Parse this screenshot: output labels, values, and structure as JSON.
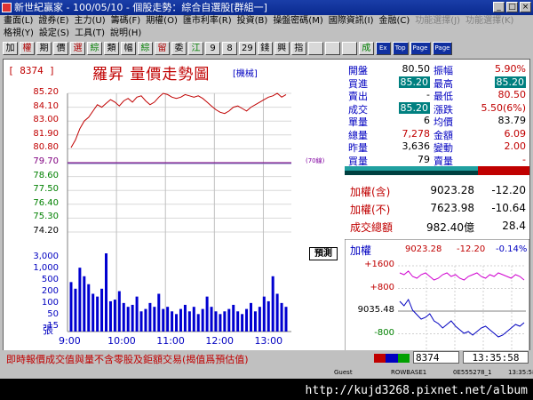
{
  "window": {
    "app_name": "新世紀贏家",
    "title_rest": " - 100/05/10 - 個股走勢：綜合自選股[群組一]",
    "buttons": [
      "_",
      "□",
      "×"
    ]
  },
  "menu": {
    "row1": [
      "畫面(L)",
      "證券(E)",
      "主力(U)",
      "籌碼(F)",
      "期權(O)",
      "匯市利率(R)",
      "投資(B)",
      "操盤密碼(M)",
      "國際資訊(I)",
      "金融(C)",
      "功能選擇(J)",
      "功能選擇(K)"
    ],
    "row2": [
      "格視(Y)",
      "設定(S)",
      "工具(T)",
      "說明(H)"
    ]
  },
  "toolbar": [
    "加",
    "權",
    "期",
    "價",
    "選",
    "綜",
    "類",
    "幅",
    "綜",
    "留",
    "委",
    "江",
    "9",
    "8",
    "29",
    "錢",
    "興",
    "指",
    "",
    "",
    "",
    "成",
    "Ex",
    "Top",
    "Page",
    "Page"
  ],
  "stock": {
    "code": "[ 8374 ]",
    "name_title": "羅昇  量價走勢圖",
    "category": "[機械]",
    "ref_label": "(70線)",
    "estimate_label": "預測",
    "volume_unit": "張"
  },
  "price_ticks": [
    {
      "label": "85.20",
      "color": "#c00000"
    },
    {
      "label": "84.10",
      "color": "#c00000"
    },
    {
      "label": "83.00",
      "color": "#c00000"
    },
    {
      "label": "81.90",
      "color": "#c00000"
    },
    {
      "label": "80.80",
      "color": "#c00000"
    },
    {
      "label": "79.70",
      "color": "#800080"
    },
    {
      "label": "78.60",
      "color": "#008000"
    },
    {
      "label": "77.50",
      "color": "#008000"
    },
    {
      "label": "76.40",
      "color": "#008000"
    },
    {
      "label": "75.30",
      "color": "#008000"
    },
    {
      "label": "74.20",
      "color": "#000000"
    }
  ],
  "volume_ticks": [
    "3,000",
    "1,000",
    "500",
    "200",
    "100",
    "50",
    "15"
  ],
  "time_ticks": [
    "9:00",
    "10:00",
    "11:00",
    "12:00",
    "13:00"
  ],
  "chart_data": {
    "type": "line",
    "series": [
      {
        "values": [
          80.9,
          81.5,
          82.4,
          83.0,
          83.3,
          83.8,
          84.3,
          84.1,
          84.4,
          84.7,
          84.5,
          84.2,
          84.6,
          84.8,
          84.5,
          84.9,
          85.0,
          84.6,
          84.3,
          84.5,
          84.9,
          85.2,
          85.1,
          84.9,
          84.8,
          84.9,
          85.1,
          85.0,
          84.9,
          85.0,
          84.8,
          84.5,
          84.2,
          83.9,
          83.7,
          83.6,
          83.8,
          84.1,
          84.2,
          84.0,
          83.8,
          84.1,
          84.3,
          84.5,
          84.7,
          84.9,
          85.0,
          85.2,
          84.9,
          85.1
        ]
      }
    ],
    "reference_price": 79.7,
    "ylim": [
      74.2,
      85.2
    ],
    "x": [
      "9:00",
      "10:00",
      "11:00",
      "12:00",
      "13:00"
    ],
    "volume_bars": [
      120,
      90,
      200,
      150,
      110,
      70,
      60,
      90,
      300,
      45,
      50,
      80,
      40,
      30,
      35,
      60,
      20,
      25,
      40,
      30,
      70,
      25,
      30,
      20,
      15,
      25,
      35,
      20,
      30,
      15,
      25,
      60,
      30,
      20,
      15,
      20,
      25,
      35,
      20,
      15,
      25,
      40,
      20,
      30,
      60,
      45,
      150,
      70,
      40,
      30
    ]
  },
  "quote": {
    "rows": [
      {
        "l1": "開盤",
        "v1": "80.50",
        "l2": "振幅",
        "v2": "5.90%",
        "c1": "#000000",
        "c2": "#c00000"
      },
      {
        "l1": "買進",
        "v1": "85.20",
        "l2": "最高",
        "v2": "85.20",
        "c1": "#000000",
        "c2": "#c00000"
      },
      {
        "l1": "賣出",
        "v1": "-",
        "l2": "最低",
        "v2": "80.50",
        "c1": "#000000",
        "c2": "#c00000"
      },
      {
        "l1": "成交",
        "v1": "85.20",
        "l2": "漲跌",
        "v2": "5.50(6%)",
        "c1": "#000000",
        "c2": "#c00000"
      },
      {
        "l1": "單量",
        "v1": "6",
        "l2": "均價",
        "v2": "83.79",
        "c1": "#000000",
        "c2": "#000000"
      },
      {
        "l1": "總量",
        "v1": "7,278",
        "l2": "金額",
        "v2": "6.09",
        "c1": "#c00000",
        "c2": "#c00000"
      },
      {
        "l1": "昨量",
        "v1": "3,636",
        "l2": "變動",
        "v2": "2.00",
        "c1": "#000000",
        "c2": "#c00000"
      },
      {
        "l1": "買量",
        "v1": "79",
        "l2": "賣量",
        "v2": "-",
        "c1": "#000000",
        "c2": "#c00000"
      }
    ]
  },
  "index": {
    "rows": [
      {
        "label": "加權(含)",
        "v1": "9023.28",
        "v2": "-12.20"
      },
      {
        "label": "加權(不)",
        "v1": "7623.98",
        "v2": "-10.64"
      },
      {
        "label": "成交總額",
        "v1": "982.40億",
        "v2": "28.4"
      }
    ]
  },
  "mini_chart": {
    "title": "加權",
    "value": "9023.28",
    "change": "-12.20",
    "pct": "-0.14%",
    "ticks": [
      "+1600",
      "+800",
      "9035.48",
      "-800",
      "-1600"
    ]
  },
  "status": {
    "message": "即時報價成交值與量不含零股及鉅額交易(揭值爲預估值)",
    "code": "8374",
    "time": "13:35:58"
  },
  "taskbar": {
    "items": [
      "Guest",
      "ROWBASE1",
      "0E555278_1",
      "13:35:58"
    ]
  },
  "watermark": "http://kujd3268.pixnet.net/album"
}
